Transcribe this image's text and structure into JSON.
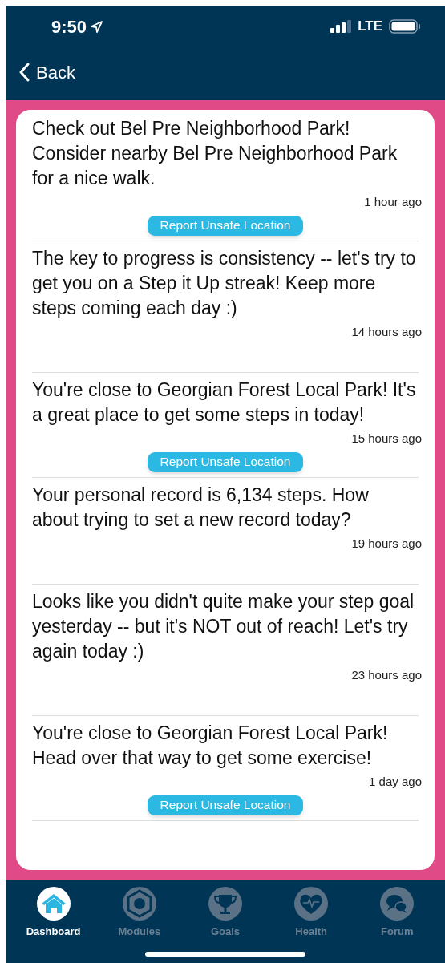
{
  "status_bar": {
    "time": "9:50",
    "network": "LTE"
  },
  "nav": {
    "back": "Back"
  },
  "messages": [
    {
      "text": "Check out Bel Pre Neighborhood Park! Consider nearby Bel Pre Neighborhood Park for a nice walk.",
      "time": "1 hour ago",
      "report": "Report Unsafe Location"
    },
    {
      "text": "The key to progress is consistency -- let's try to get you on a Step it Up streak! Keep more steps coming each day :)",
      "time": "14 hours ago"
    },
    {
      "text": "You're close to Georgian Forest Local Park! It's a great place to get some steps in today!",
      "time": "15 hours ago",
      "report": "Report Unsafe Location"
    },
    {
      "text": "Your personal record is 6,134 steps. How about trying to set a new record today?",
      "time": "19 hours ago"
    },
    {
      "text": "Looks like you didn't quite make your step goal yesterday -- but it's NOT out of reach! Let's try again today :)",
      "time": "23 hours ago"
    },
    {
      "text": "You're close to Georgian Forest Local Park! Head over that way to get some exercise!",
      "time": "1 day ago",
      "report": "Report Unsafe Location"
    }
  ],
  "tabs": [
    {
      "label": "Dashboard",
      "kind": "home",
      "selected": true
    },
    {
      "label": "Modules",
      "kind": "modules",
      "selected": false
    },
    {
      "label": "Goals",
      "kind": "goals",
      "selected": false
    },
    {
      "label": "Health",
      "kind": "health",
      "selected": false
    },
    {
      "label": "Forum",
      "kind": "forum",
      "selected": false
    }
  ]
}
